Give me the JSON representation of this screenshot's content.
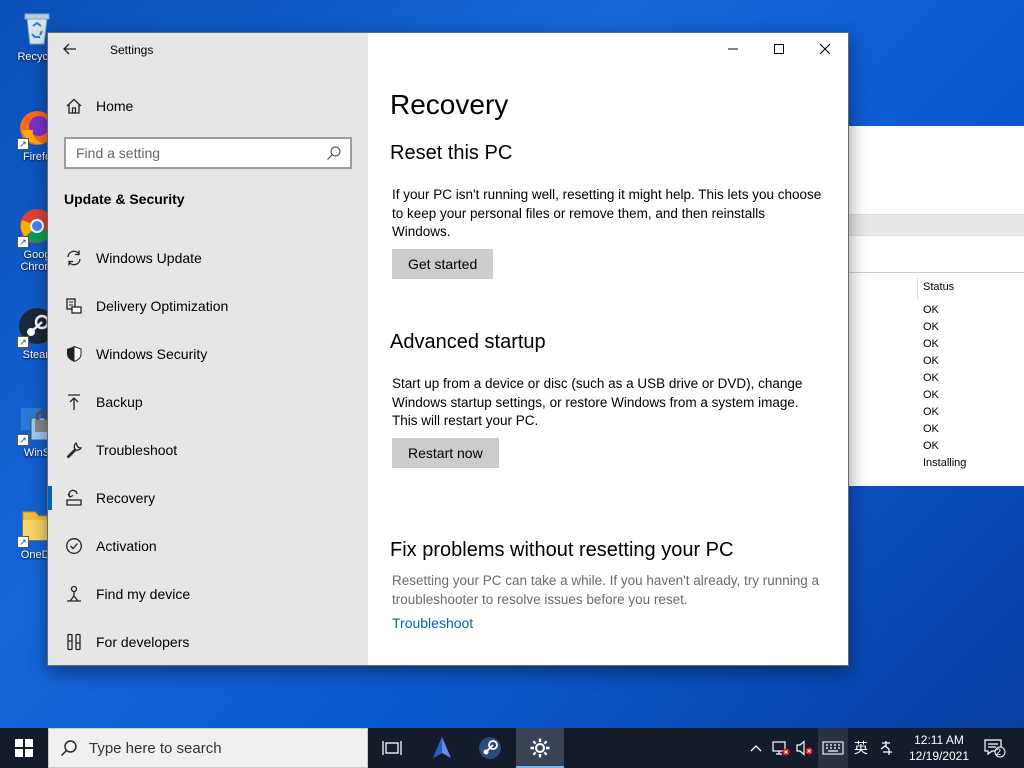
{
  "desktop": {
    "icons": [
      {
        "label": "Recycle",
        "icon": "recycle-bin-icon"
      },
      {
        "label": "Firefo",
        "icon": "firefox-icon"
      },
      {
        "label": "Goog",
        "label2": "Chrom",
        "icon": "chrome-icon"
      },
      {
        "label": "Stean",
        "icon": "steam-icon"
      },
      {
        "label": "WinS",
        "icon": "winscp-icon"
      },
      {
        "label": "OneDr",
        "icon": "onedrive-icon"
      }
    ]
  },
  "background_window": {
    "status_header": "Status",
    "status_values": [
      "OK",
      "OK",
      "OK",
      "OK",
      "OK",
      "OK",
      "OK",
      "OK",
      "OK",
      "Installing"
    ]
  },
  "settings": {
    "window_title": "Settings",
    "sidebar": {
      "home_label": "Home",
      "search_placeholder": "Find a setting",
      "section_title": "Update & Security",
      "items": [
        {
          "label": "Windows Update",
          "icon": "sync-icon"
        },
        {
          "label": "Delivery Optimization",
          "icon": "delivery-optimization-icon"
        },
        {
          "label": "Windows Security",
          "icon": "shield-icon"
        },
        {
          "label": "Backup",
          "icon": "upload-arrow-icon"
        },
        {
          "label": "Troubleshoot",
          "icon": "wrench-icon"
        },
        {
          "label": "Recovery",
          "icon": "recovery-icon",
          "active": true
        },
        {
          "label": "Activation",
          "icon": "check-circle-icon"
        },
        {
          "label": "Find my device",
          "icon": "person-pin-icon"
        },
        {
          "label": "For developers",
          "icon": "developer-tools-icon"
        }
      ]
    },
    "content": {
      "page_title": "Recovery",
      "reset": {
        "heading": "Reset this PC",
        "description": "If your PC isn't running well, resetting it might help. This lets you choose to keep your personal files or remove them, and then reinstalls Windows.",
        "button": "Get started"
      },
      "advanced": {
        "heading": "Advanced startup",
        "description": "Start up from a device or disc (such as a USB drive or DVD), change Windows startup settings, or restore Windows from a system image. This will restart your PC.",
        "button": "Restart now"
      },
      "fix": {
        "heading": "Fix problems without resetting your PC",
        "description": "Resetting your PC can take a while. If you haven't already, try running a troubleshooter to resolve issues before you reset.",
        "link": "Troubleshoot"
      }
    }
  },
  "taskbar": {
    "search_placeholder": "Type here to search",
    "ime_label": "英",
    "time": "12:11 AM",
    "date": "12/19/2021",
    "notification_count": "2",
    "accent_color": "#76b9ed"
  }
}
